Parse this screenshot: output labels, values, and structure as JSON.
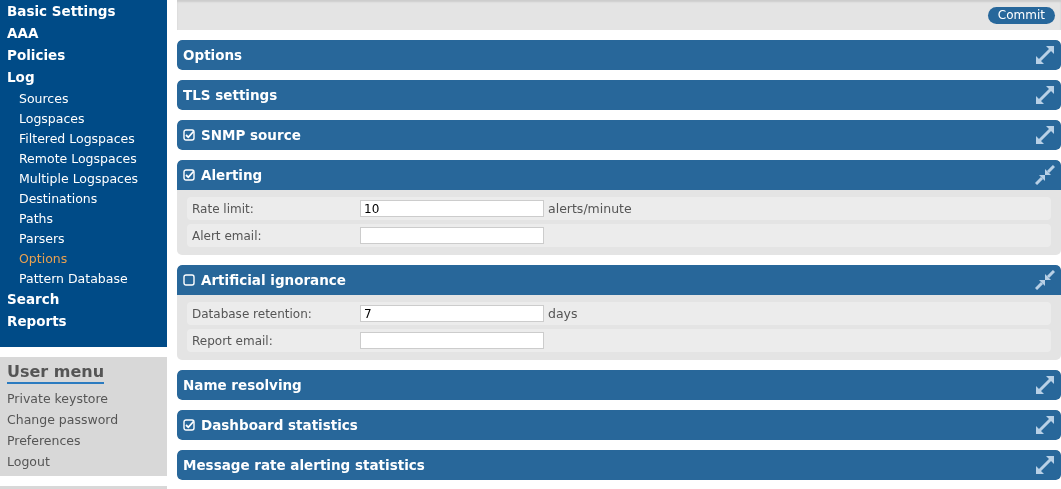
{
  "nav": [
    {
      "label": "Basic Settings",
      "selected": false
    },
    {
      "label": "AAA",
      "selected": false
    },
    {
      "label": "Policies",
      "selected": false
    },
    {
      "label": "Log",
      "selected": false,
      "children": [
        {
          "label": "Sources",
          "selected": false
        },
        {
          "label": "Logspaces",
          "selected": false
        },
        {
          "label": "Filtered Logspaces",
          "selected": false
        },
        {
          "label": "Remote Logspaces",
          "selected": false
        },
        {
          "label": "Multiple Logspaces",
          "selected": false
        },
        {
          "label": "Destinations",
          "selected": false
        },
        {
          "label": "Paths",
          "selected": false
        },
        {
          "label": "Parsers",
          "selected": false
        },
        {
          "label": "Options",
          "selected": true
        },
        {
          "label": "Pattern Database",
          "selected": false
        }
      ]
    },
    {
      "label": "Search",
      "selected": false
    },
    {
      "label": "Reports",
      "selected": false
    }
  ],
  "user_menu": {
    "title": "User menu",
    "items": [
      "Private keystore",
      "Change password",
      "Preferences",
      "Logout"
    ]
  },
  "toolbar": {
    "commit": "Commit"
  },
  "sections": [
    {
      "title": "Options",
      "expanded": false
    },
    {
      "title": "TLS settings",
      "expanded": false
    },
    {
      "title": "SNMP source",
      "checked": true,
      "expanded": false
    },
    {
      "title": "Alerting",
      "checked": true,
      "expanded": true,
      "rows": [
        {
          "label": "Rate limit:",
          "value": "10",
          "unit": "alerts/minute"
        },
        {
          "label": "Alert email:"
        }
      ]
    },
    {
      "title": "Artificial ignorance",
      "checked": false,
      "expanded": true,
      "rows": [
        {
          "label": "Database retention:",
          "value": "7",
          "unit": "days"
        },
        {
          "label": "Report email:"
        }
      ]
    },
    {
      "title": "Name resolving",
      "expanded": false
    },
    {
      "title": "Dashboard statistics",
      "checked": true,
      "expanded": false
    },
    {
      "title": "Message rate alerting statistics",
      "expanded": false
    }
  ]
}
